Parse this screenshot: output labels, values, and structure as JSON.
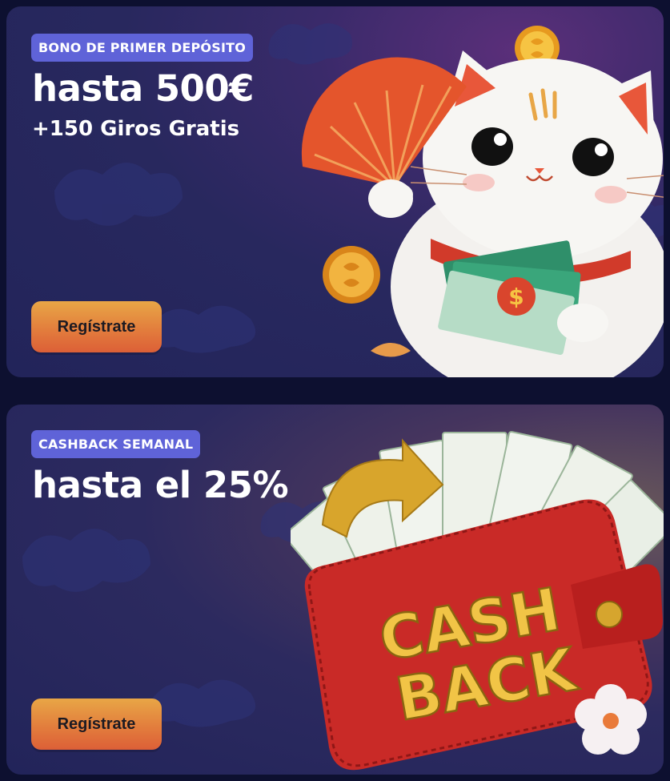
{
  "promos": [
    {
      "badge": "BONO DE PRIMER DEPÓSITO",
      "headline": "hasta 500€",
      "subline": "+150 Giros Gratis",
      "button": "Regístrate",
      "art": "lucky-cat"
    },
    {
      "badge": "CASHBACK SEMANAL",
      "headline": "hasta el 25%",
      "button": "Regístrate",
      "art": "cashback-wallet",
      "art_text": [
        "CASH",
        "BACK"
      ]
    }
  ],
  "colors": {
    "page_bg": "#0d1030",
    "card_bg": "#24265c",
    "badge_bg": "#5f63d8",
    "button_gradient_top": "#e8a646",
    "button_gradient_bottom": "#dc5f37"
  }
}
